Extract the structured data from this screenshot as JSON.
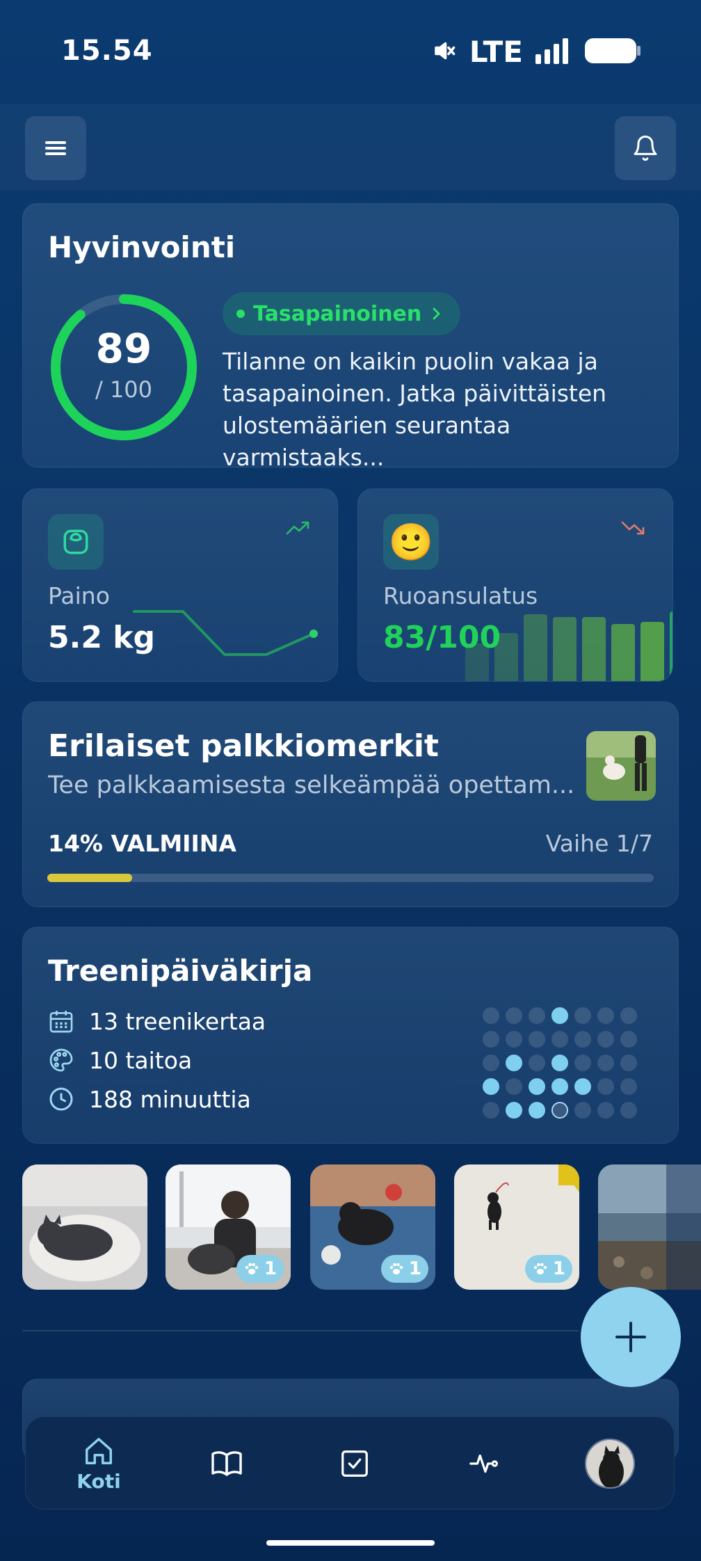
{
  "status_bar": {
    "time": "15.54",
    "network": "LTE"
  },
  "wellbeing": {
    "title": "Hyvinvointi",
    "score": "89",
    "score_max": "/ 100",
    "score_value": 89,
    "status_badge": "Tasapainoinen",
    "description": "Tilanne on kaikin puolin vakaa ja tasapainoinen. Jatka päivittäisten ulostemäärien seurantaa varmistaaks..."
  },
  "weight": {
    "label": "Paino",
    "value": "5.2 kg",
    "trend": "up",
    "color": "#2ab86a"
  },
  "food": {
    "label": "Ruoansulatus",
    "value": "83/100",
    "trend": "down",
    "trend_color": "#e07a6a",
    "emoji": "🙂",
    "bars": [
      0.55,
      0.7,
      0.96,
      0.92,
      0.92,
      0.82,
      0.85,
      1.0
    ]
  },
  "badges_course": {
    "title": "Erilaiset palkkiomerkit",
    "subtitle": "Tee palkkaamisesta selkeämpää opettam...",
    "progress_label": "14% VALMIINA",
    "progress": 0.14,
    "step": "Vaihe 1/7"
  },
  "diary": {
    "title": "Treenipäiväkirja",
    "sessions": "13 treenikertaa",
    "skills": "10 taitoa",
    "minutes": "188 minuuttia",
    "activity_grid": [
      [
        0,
        0,
        0,
        2,
        0,
        0,
        0
      ],
      [
        0,
        0,
        0,
        0,
        0,
        0,
        0
      ],
      [
        0,
        2,
        0,
        2,
        0,
        0,
        0
      ],
      [
        2,
        0,
        2,
        2,
        2,
        0,
        0
      ],
      [
        0,
        2,
        2,
        3,
        0,
        0,
        0
      ]
    ]
  },
  "photos": [
    {
      "badge": ""
    },
    {
      "badge": "1"
    },
    {
      "badge": "1"
    },
    {
      "badge": "1"
    },
    {
      "badge": ""
    }
  ],
  "nav": {
    "home_label": "Koti",
    "active_color": "#8fd3ef"
  }
}
